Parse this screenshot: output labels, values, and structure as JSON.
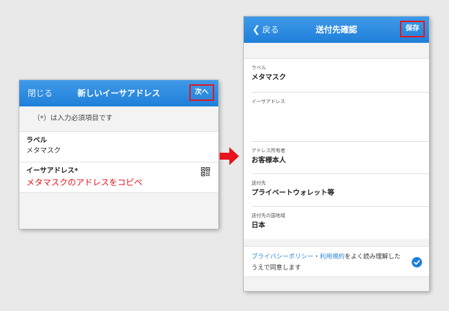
{
  "left_screen": {
    "close_label": "閉じる",
    "title": "新しいイーサアドレス",
    "next_label": "次へ",
    "required_note": "（*）は入力必須項目です",
    "label_field": {
      "label": "ラベル",
      "value": "メタマスク"
    },
    "address_field": {
      "label": "イーサアドレス*",
      "annotation": "メタマスクのアドレスをコピペ"
    },
    "qr_icon": "qr-code-icon"
  },
  "arrow_icon": "right-arrow-icon",
  "right_screen": {
    "back_label": "戻る",
    "title": "送付先確認",
    "save_label": "保存",
    "fields": [
      {
        "sub_label": "ラベル",
        "value": "メタマスク"
      },
      {
        "sub_label": "イーサアドレス",
        "value": ""
      },
      {
        "sub_label": "アドレス所有者",
        "value": "お客様本人"
      },
      {
        "sub_label": "送付先",
        "value": "プライベートウォレット等"
      },
      {
        "sub_label": "送付先の国地域",
        "value": "日本"
      }
    ],
    "privacy": {
      "link_privacy": "プライバシーポリシー",
      "separator": "・",
      "link_terms": "利用規約",
      "text": "をよく読み理解したうえで同意します",
      "agreed": true
    }
  },
  "colors": {
    "nav_blue": "#1f7fd9",
    "highlight_red": "#e8131c",
    "link_blue": "#2d86d8"
  }
}
